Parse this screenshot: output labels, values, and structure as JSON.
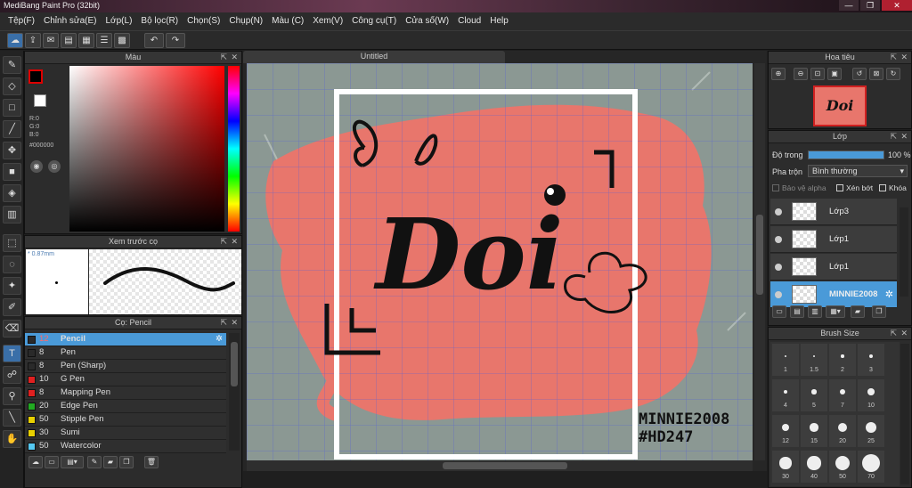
{
  "app": {
    "title": "MediBang Paint Pro (32bit)"
  },
  "menu": [
    "Tệp(F)",
    "Chỉnh sửa(E)",
    "Lớp(L)",
    "Bộ lọc(R)",
    "Chọn(S)",
    "Chụp(N)",
    "Màu (C)",
    "Xem(V)",
    "Công cụ(T)",
    "Cửa số(W)",
    "Cloud",
    "Help"
  ],
  "color_panel": {
    "title": "Màu",
    "r": "R:0",
    "g": "G:0",
    "b": "B:0",
    "hex": "#000000"
  },
  "preview_panel": {
    "title": "Xem trước cọ",
    "size": "0.87mm"
  },
  "brush_panel": {
    "title": "Cọ: Pencil",
    "brushes": [
      {
        "size": "12",
        "name": "Pencil",
        "color": "#2a2a2a",
        "selected": true
      },
      {
        "size": "8",
        "name": "Pen",
        "color": "#2a2a2a"
      },
      {
        "size": "8",
        "name": "Pen (Sharp)",
        "color": "#2a2a2a"
      },
      {
        "size": "10",
        "name": "G Pen",
        "color": "#e02020"
      },
      {
        "size": "8",
        "name": "Mapping Pen",
        "color": "#e02020"
      },
      {
        "size": "20",
        "name": "Edge Pen",
        "color": "#22aa22"
      },
      {
        "size": "50",
        "name": "Stipple Pen",
        "color": "#e8d000"
      },
      {
        "size": "30",
        "name": "Sumi",
        "color": "#e8d000"
      },
      {
        "size": "50",
        "name": "Watercolor",
        "color": "#55c8f0"
      }
    ]
  },
  "canvas": {
    "tab": "Untitled",
    "art_text": "Doi",
    "watermark_line1": "MINNIE2008",
    "watermark_line2": "#HD247"
  },
  "navigator": {
    "title": "Hoa tiêu",
    "thumb_text": "Doi"
  },
  "layer_panel": {
    "title": "Lớp",
    "opacity_label": "Độ trong",
    "opacity_value": "100 %",
    "opacity": 1.0,
    "blend_label": "Pha trộn",
    "blend_value": "Bình thường",
    "protect_alpha": "Bảo vệ alpha",
    "clipping": "Xén bớt",
    "lock": "Khóa",
    "layers": [
      {
        "name": "Lớp3",
        "selected": false
      },
      {
        "name": "Lớp1",
        "selected": false
      },
      {
        "name": "Lớp1",
        "selected": false
      },
      {
        "name": "MINNIE2008",
        "selected": true
      }
    ]
  },
  "brush_size": {
    "title": "Brush Size",
    "sizes": [
      "1",
      "1.5",
      "2",
      "3",
      "4",
      "5",
      "7",
      "10",
      "12",
      "15",
      "20",
      "25",
      "30",
      "40",
      "50",
      "70"
    ]
  },
  "colors": {
    "accent": "#4a9ad8",
    "paint": "#e8766c"
  }
}
